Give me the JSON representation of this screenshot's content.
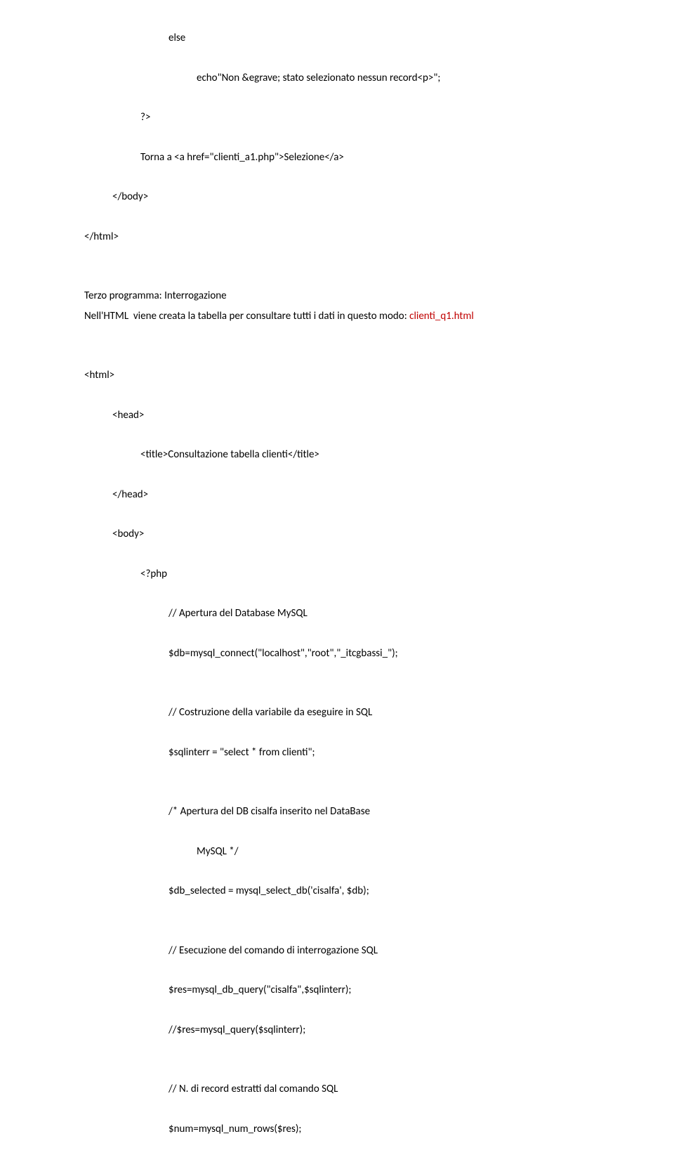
{
  "lines": [
    {
      "indent": 3,
      "text": "else"
    },
    {
      "gap": true
    },
    {
      "indent": 4,
      "text": "echo\"Non &egrave; stato selezionato nessun record<p>\";"
    },
    {
      "gap": true
    },
    {
      "indent": 2,
      "text": "?>"
    },
    {
      "gap": true
    },
    {
      "indent": 2,
      "text": "Torna a <a href=\"clienti_a1.php\">Selezione</a>"
    },
    {
      "gap": true
    },
    {
      "indent": 1,
      "text": "</body>"
    },
    {
      "gap": true
    },
    {
      "indent": 0,
      "text": "</html>"
    },
    {
      "gap": true
    },
    {
      "gap": true
    },
    {
      "indent": 0,
      "text": "Terzo programma: Interrogazione"
    },
    {
      "indent": 0,
      "mixed": true,
      "parts": [
        {
          "text": "Nell'HTML  viene creata la tabella per consultare tutti i dati in questo modo: "
        },
        {
          "text": "clienti_q1.html",
          "class": "red"
        }
      ]
    },
    {
      "gap": true
    },
    {
      "gap": true
    },
    {
      "indent": 0,
      "text": "<html>"
    },
    {
      "gap": true
    },
    {
      "indent": 1,
      "text": "<head>"
    },
    {
      "gap": true
    },
    {
      "indent": 2,
      "text": "<title>Consultazione tabella clienti</title>"
    },
    {
      "gap": true
    },
    {
      "indent": 1,
      "text": "</head>"
    },
    {
      "gap": true
    },
    {
      "indent": 1,
      "text": "<body>"
    },
    {
      "gap": true
    },
    {
      "indent": 2,
      "text": "<?php"
    },
    {
      "gap": true
    },
    {
      "indent": 3,
      "text": "// Apertura del Database MySQL"
    },
    {
      "gap": true
    },
    {
      "indent": 3,
      "text": "$db=mysql_connect(\"localhost\",\"root\",\"_itcgbassi_\");"
    },
    {
      "gap": true
    },
    {
      "gap": true
    },
    {
      "indent": 3,
      "text": "// Costruzione della variabile da eseguire in SQL"
    },
    {
      "gap": true
    },
    {
      "indent": 3,
      "text": "$sqlinterr = \"select * from clienti\";"
    },
    {
      "gap": true
    },
    {
      "gap": true
    },
    {
      "indent": 3,
      "text": "/* Apertura del DB cisalfa inserito nel DataBase"
    },
    {
      "gap": true
    },
    {
      "indent": 4,
      "text": "MySQL */"
    },
    {
      "gap": true
    },
    {
      "indent": 3,
      "text": "$db_selected = mysql_select_db('cisalfa', $db);"
    },
    {
      "gap": true
    },
    {
      "gap": true
    },
    {
      "indent": 3,
      "text": "// Esecuzione del comando di interrogazione SQL"
    },
    {
      "gap": true
    },
    {
      "indent": 3,
      "text": "$res=mysql_db_query(\"cisalfa\",$sqlinterr);"
    },
    {
      "gap": true
    },
    {
      "indent": 3,
      "text": "//$res=mysql_query($sqlinterr);"
    },
    {
      "gap": true
    },
    {
      "gap": true
    },
    {
      "indent": 3,
      "text": "// N. di record estratti dal comando SQL"
    },
    {
      "gap": true
    },
    {
      "indent": 3,
      "text": "$num=mysql_num_rows($res);"
    }
  ]
}
